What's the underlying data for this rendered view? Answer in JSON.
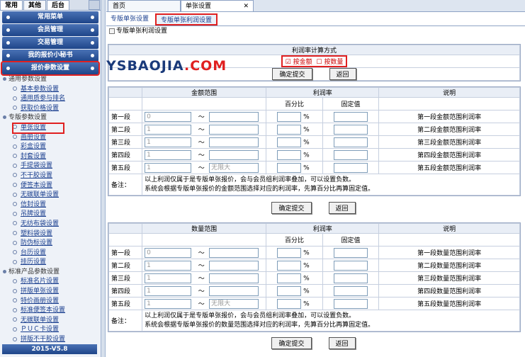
{
  "sidebar": {
    "top_tabs": [
      "常用",
      "其他",
      "后台"
    ],
    "menu": [
      "常用菜单",
      "会员管理",
      "交易管理",
      "我的报价小秘书",
      "报价参数设置"
    ],
    "groups": [
      {
        "title": "通用参数设置",
        "items": [
          "基本参数设置",
          "通用质参与排名",
          "获取价格设置"
        ]
      },
      {
        "title": "专版参数设置",
        "items": [
          "单张设置",
          "画册设置",
          "彩盒设置",
          "封套设置",
          "手提袋设置",
          "不干胶设置",
          "便签本设置",
          "无碳联单设置",
          "信封设置",
          "吊牌设置",
          "无纺布袋设置",
          "塑料袋设置",
          "防伪标设置",
          "台历设置",
          "挂历设置"
        ]
      },
      {
        "title": "标准产品参数设置",
        "items": [
          "标准名片设置",
          "拼版单张设置",
          "特价画册设置",
          "标准便签本设置",
          "无碳联单设置",
          "ＰＵＣ卡设置",
          "拼版不干胶设置"
        ]
      }
    ],
    "version": "2015-V5.8"
  },
  "tabs": [
    "首页",
    "单张设置"
  ],
  "subtabs": [
    "专版单张设置",
    "专版单张利润设置"
  ],
  "crumb": "专版单张利润设置",
  "method": {
    "title": "利润率计算方式",
    "opt1": "按金额",
    "opt2": "按数量",
    "submit": "确定提交",
    "back": "返回"
  },
  "watermark": {
    "a": "YSBAOJIA",
    "b": ".COM"
  },
  "amount": {
    "h1": "金额范围",
    "h2": "利润率",
    "h3": "说明",
    "pct": "百分比",
    "fixed": "固定值",
    "rows": [
      {
        "seg": "第一段",
        "from": "0",
        "to": "",
        "desc": "第一段金额范围利润率"
      },
      {
        "seg": "第二段",
        "from": "1",
        "to": "",
        "desc": "第二段金额范围利润率"
      },
      {
        "seg": "第三段",
        "from": "1",
        "to": "",
        "desc": "第三段金额范围利润率"
      },
      {
        "seg": "第四段",
        "from": "1",
        "to": "",
        "desc": "第四段金额范围利润率"
      },
      {
        "seg": "第五段",
        "from": "1",
        "to": "无限大",
        "desc": "第五段金额范围利润率"
      }
    ],
    "note_label": "备注：",
    "note1": "以上利润仅属于是专版单张报价，会与会员组利润率叠加，可以设置负数。",
    "note2": "系统会根据专版单张报价的金额范围选择对应的利润率，先算百分比再算固定值。"
  },
  "qty": {
    "h1": "数量范围",
    "h2": "利润率",
    "h3": "说明",
    "pct": "百分比",
    "fixed": "固定值",
    "rows": [
      {
        "seg": "第一段",
        "from": "0",
        "to": "",
        "desc": "第一段数量范围利润率"
      },
      {
        "seg": "第二段",
        "from": "1",
        "to": "",
        "desc": "第二段数量范围利润率"
      },
      {
        "seg": "第三段",
        "from": "1",
        "to": "",
        "desc": "第三段数量范围利润率"
      },
      {
        "seg": "第四段",
        "from": "1",
        "to": "",
        "desc": "第四段数量范围利润率"
      },
      {
        "seg": "第五段",
        "from": "1",
        "to": "无限大",
        "desc": "第五段数量范围利润率"
      }
    ],
    "note_label": "备注：",
    "note1": "以上利润仅属于是专版单张报价，会与会员组利润率叠加，可以设置负数。",
    "note2": "系统会根据专版单张报价的数量范围选择对应的利润率，先算百分比再算固定值。"
  },
  "buttons": {
    "submit": "确定提交",
    "back": "返回"
  },
  "tilde": "～",
  "pct_sign": "%"
}
